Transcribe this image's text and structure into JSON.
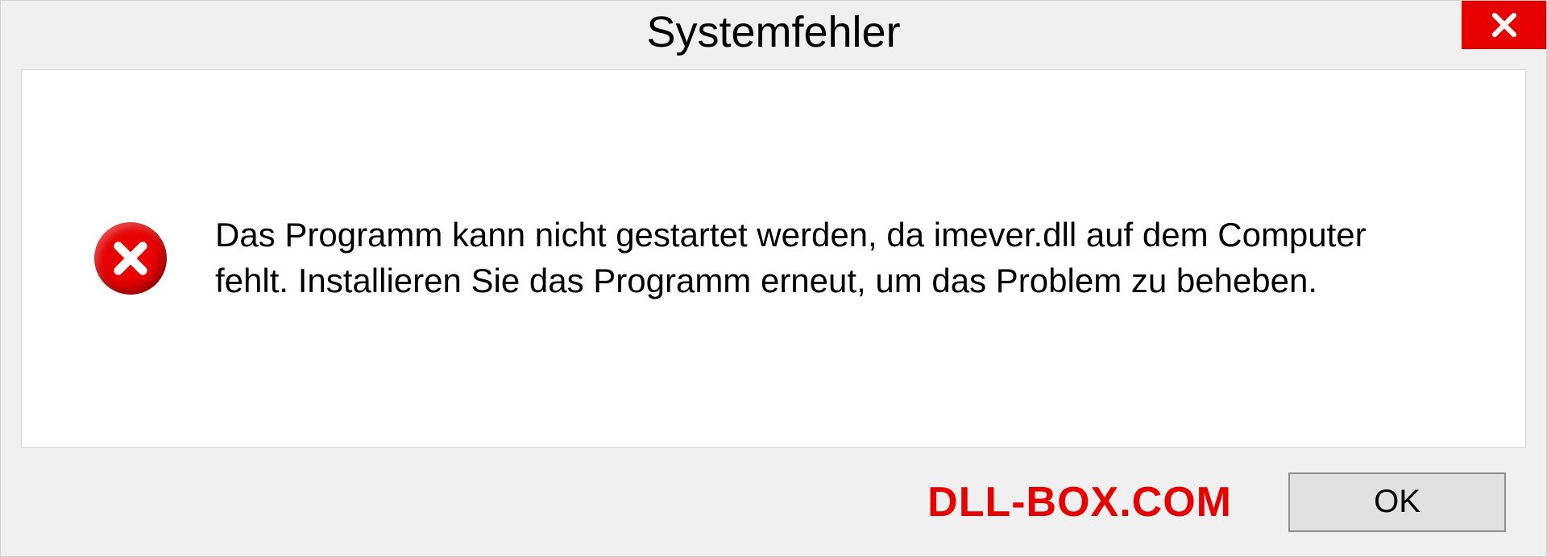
{
  "dialog": {
    "title": "Systemfehler",
    "message": "Das Programm kann nicht gestartet werden, da imever.dll auf dem Computer fehlt. Installieren Sie das Programm erneut, um das Problem zu beheben.",
    "ok_label": "OK",
    "watermark": "DLL-BOX.COM"
  }
}
